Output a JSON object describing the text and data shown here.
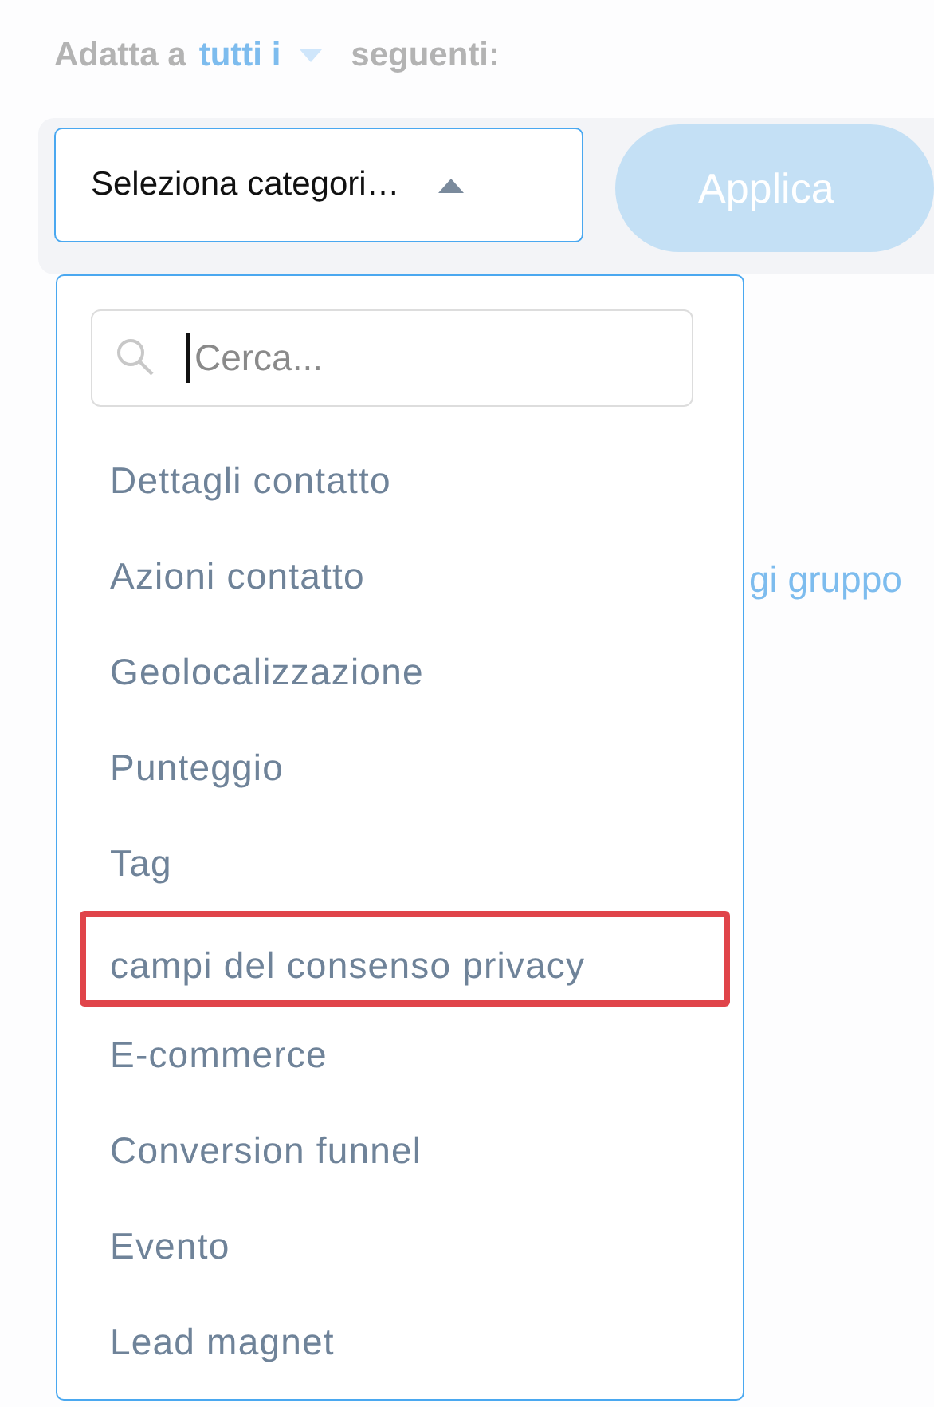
{
  "match_line": {
    "prefix": "Adatta a",
    "mode": "tutti i",
    "suffix": "seguenti:"
  },
  "toolbar": {
    "select": {
      "value": "Seleziona categori…",
      "expanded": true
    },
    "apply_button": "Applica"
  },
  "background_link": "gi gruppo",
  "dropdown": {
    "search": {
      "placeholder": "Cerca..."
    },
    "items": [
      {
        "label": "Dettagli contatto",
        "highlighted": false
      },
      {
        "label": "Azioni contatto",
        "highlighted": false
      },
      {
        "label": "Geolocalizzazione",
        "highlighted": false
      },
      {
        "label": "Punteggio",
        "highlighted": false
      },
      {
        "label": "Tag",
        "highlighted": false
      },
      {
        "label": "campi del consenso privacy",
        "highlighted": true
      },
      {
        "label": "E-commerce",
        "highlighted": false
      },
      {
        "label": "Conversion funnel",
        "highlighted": false
      },
      {
        "label": "Evento",
        "highlighted": false
      },
      {
        "label": "Lead magnet",
        "highlighted": false
      }
    ]
  }
}
